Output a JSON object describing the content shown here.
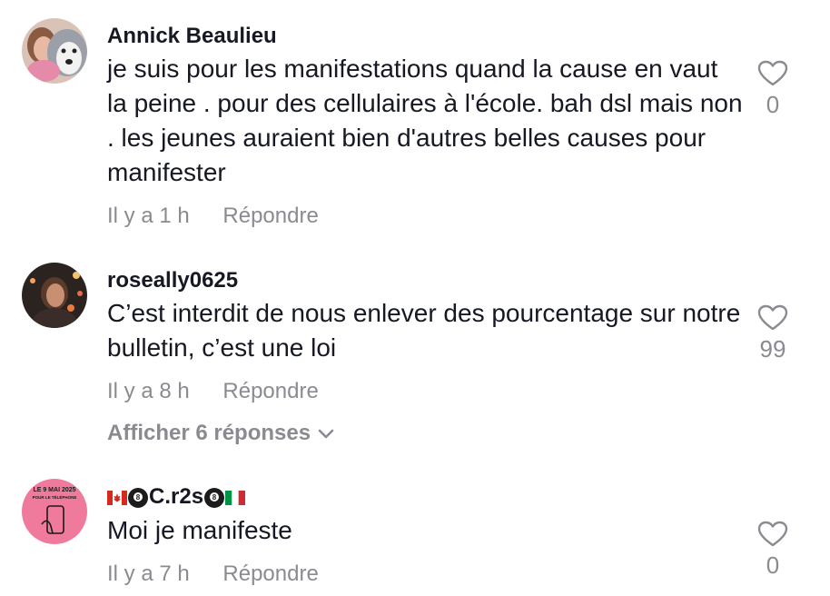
{
  "comments": [
    {
      "username": "Annick Beaulieu",
      "text": "je suis pour les manifestations quand la cause en vaut la peine . pour des cellulaires à l'école. bah dsl mais non . les jeunes auraient bien d'autres belles causes pour manifester",
      "time": "Il y a 1 h",
      "reply_label": "Répondre",
      "likes": "0"
    },
    {
      "username": "roseally0625",
      "text": "C’est interdit de nous enlever des pourcentage sur notre bulletin, c’est une loi",
      "time": "Il y a 8 h",
      "reply_label": "Répondre",
      "likes": "99",
      "view_replies": "Afficher 6 réponses"
    },
    {
      "username_core": "C.r2s",
      "text": "Moi je manifeste",
      "time": "Il y a 7 h",
      "reply_label": "Répondre",
      "likes": "0",
      "avatar_text": [
        "LE 9 MAI 2025",
        "POUR LE TÉLÉPHONE"
      ]
    }
  ],
  "colors": {
    "text_primary": "#161823",
    "text_secondary": "#8a8b91",
    "avatar3_bg": "#f07a9c"
  }
}
